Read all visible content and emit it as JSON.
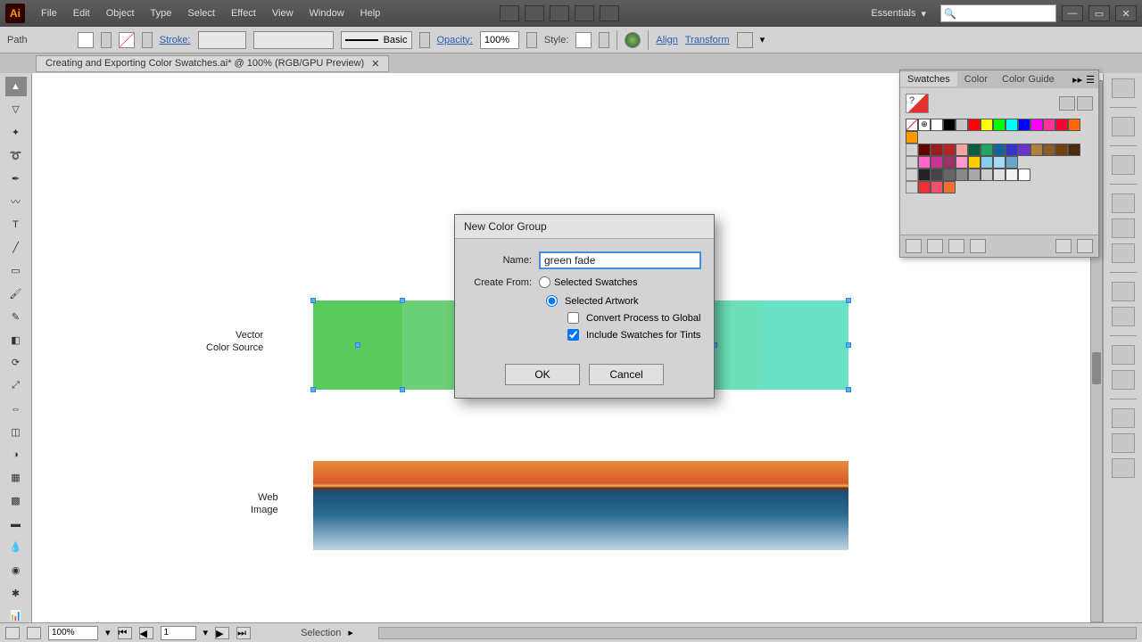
{
  "menubar": {
    "items": [
      "File",
      "Edit",
      "Object",
      "Type",
      "Select",
      "Effect",
      "View",
      "Window",
      "Help"
    ]
  },
  "workspace": {
    "label": "Essentials"
  },
  "control_bar": {
    "mode": "Path",
    "stroke_label": "Stroke:",
    "style_label": "Basic",
    "opacity_label": "Opacity:",
    "opacity_value": "100%",
    "style2_label": "Style:",
    "align_label": "Align",
    "transform_label": "Transform"
  },
  "doc_tab": {
    "title": "Creating and Exporting Color Swatches.ai* @ 100% (RGB/GPU Preview)"
  },
  "canvas": {
    "vector_label_line1": "Vector",
    "vector_label_line2": "Color Source",
    "web_label_line1": "Web",
    "web_label_line2": "Image",
    "rect_colors": [
      "#5bca5e",
      "#6bd077",
      "#7dd690",
      "#6fd9a5",
      "#6de0ba",
      "#68e1c5"
    ]
  },
  "swatches_panel": {
    "tabs": [
      "Swatches",
      "Color",
      "Color Guide"
    ],
    "colors_row1": [
      "#ffffff",
      "#000000",
      "#c8c8c8",
      "#ff0000",
      "#ffff00",
      "#00ff00",
      "#00ffff",
      "#0000ff",
      "#ff00ff",
      "#ff3399",
      "#ff0033",
      "#ff6600",
      "#ff9900"
    ],
    "colors_row2": [
      "#660000",
      "#9b1c1c",
      "#b72222",
      "#f2a3a3",
      "#0a5d3a",
      "#1fa564",
      "#116699",
      "#3333cc",
      "#6633cc",
      "#b08040",
      "#8b5a2b",
      "#704214",
      "#4a2a0a"
    ],
    "colors_row3": [
      "#ff66cc",
      "#cc3399",
      "#993366",
      "#ff99cc",
      "#ffcc00",
      "#88ccee",
      "#a6d8f0",
      "#6aa7cc"
    ],
    "colors_row4": [
      "#222222",
      "#444444",
      "#666666",
      "#888888",
      "#aaaaaa",
      "#cccccc",
      "#e0e0e0",
      "#f2f2f2",
      "#ffffff"
    ],
    "colors_row5": [
      "#f03030",
      "#f05070",
      "#f07030"
    ]
  },
  "dialog": {
    "title": "New Color Group",
    "name_label": "Name:",
    "name_value": "green fade",
    "create_from_label": "Create From:",
    "radio_swatches": "Selected Swatches",
    "radio_artwork": "Selected Artwork",
    "check_convert": "Convert Process to Global",
    "check_tints": "Include Swatches for Tints",
    "ok": "OK",
    "cancel": "Cancel"
  },
  "status": {
    "zoom": "100%",
    "page": "1",
    "tool": "Selection"
  }
}
